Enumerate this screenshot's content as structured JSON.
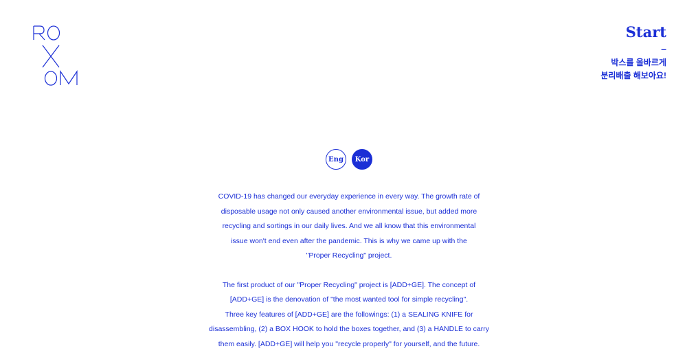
{
  "brand": {
    "logo_text": "RO X OM",
    "accent_color": "#1b2fd6"
  },
  "nav": {
    "start_label": "Start",
    "dash": "–",
    "subtitle_line1": "박스를 올바르게",
    "subtitle_line2": "분리배출 해보아요!"
  },
  "language": {
    "eng_label": "Eng",
    "kor_label": "Kor",
    "selected": "Kor"
  },
  "intro": {
    "paragraph1": [
      "COVID-19 has changed our everyday experience in every way. The growth rate of",
      "disposable usage not only caused another environmental issue, but added more",
      "recycling and sortings in our daily lives. And we all know that this environmental",
      "issue won't end even after the pandemic. This is why we came up with the",
      "\"Proper Recycling\" project."
    ],
    "paragraph2": [
      "The first product of our \"Proper Recycling\" project is [ADD+GE]. The concept of",
      "[ADD+GE] is the denovation of \"the most wanted tool for simple recycling\".",
      "Three key features of [ADD+GE] are the followings: (1) a SEALING KNIFE for",
      "disassembling, (2) a BOX HOOK to hold the boxes together, and (3) a HANDLE to carry",
      "them easily. [ADD+GE] will help you \"recycle properly\" for yourself, and the future."
    ]
  }
}
